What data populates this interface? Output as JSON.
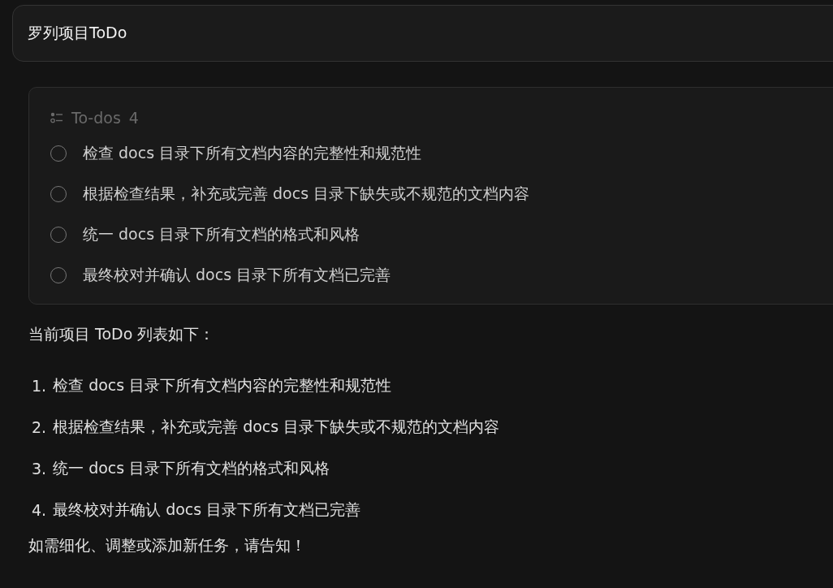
{
  "user_message": {
    "text": "罗列项目ToDo"
  },
  "todos": {
    "title": "To-dos",
    "count": "4",
    "items": [
      {
        "text": "检查 docs 目录下所有文档内容的完整性和规范性",
        "checked": false
      },
      {
        "text": "根据检查结果，补充或完善 docs 目录下缺失或不规范的文档内容",
        "checked": false
      },
      {
        "text": "统一 docs 目录下所有文档的格式和风格",
        "checked": false
      },
      {
        "text": "最终校对并确认 docs 目录下所有文档已完善",
        "checked": false
      }
    ]
  },
  "reply": {
    "intro": "当前项目 ToDo 列表如下：",
    "list": [
      {
        "number": "1.",
        "text": "检查 docs 目录下所有文档内容的完整性和规范性"
      },
      {
        "number": "2.",
        "text": "根据检查结果，补充或完善 docs 目录下缺失或不规范的文档内容"
      },
      {
        "number": "3.",
        "text": "统一 docs 目录下所有文档的格式和风格"
      },
      {
        "number": "4.",
        "text": "最终校对并确认 docs 目录下所有文档已完善"
      }
    ],
    "closing": "如需细化、调整或添加新任务，请告知！"
  }
}
